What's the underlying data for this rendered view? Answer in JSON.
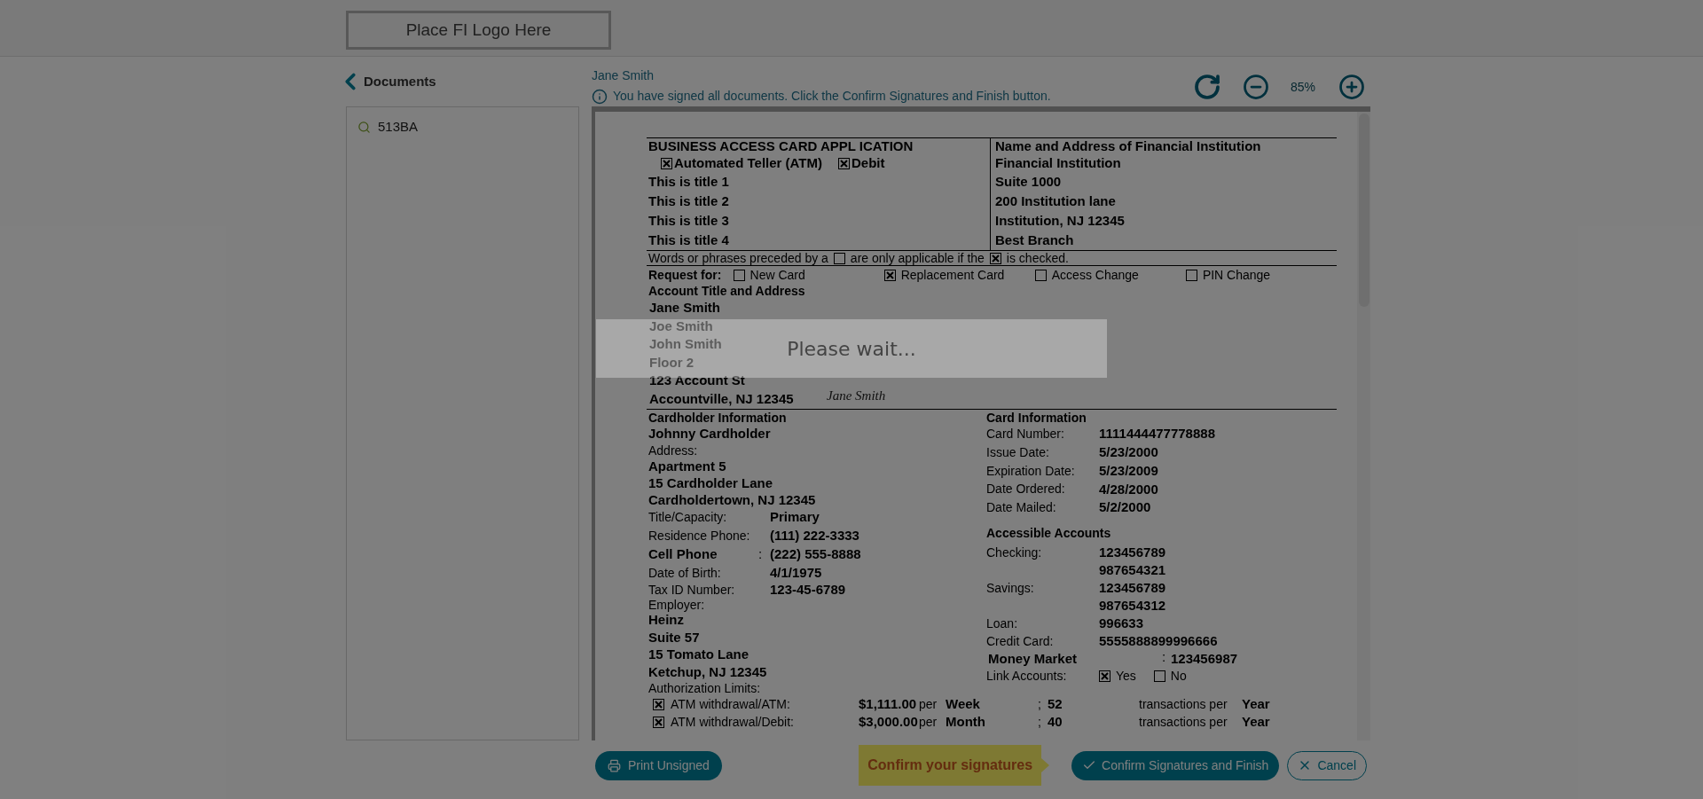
{
  "header": {
    "logo_text": "Place FI Logo Here"
  },
  "sidebar": {
    "back_label": "Documents",
    "items": [
      {
        "label": "513BA"
      }
    ]
  },
  "viewer": {
    "signer": "Jane Smith",
    "notice": "You have signed all documents. Click the Confirm Signatures and Finish button.",
    "zoom": "85%"
  },
  "document": {
    "top_left": {
      "title": "BUSINESS ACCESS CARD APPL ICATION",
      "options": [
        {
          "label": "Automated Teller (ATM)",
          "checked": true
        },
        {
          "label": "Debit",
          "checked": true
        }
      ],
      "titles": [
        "This is title 1",
        "This is title 2",
        "This is title 3",
        "This is title 4"
      ]
    },
    "top_right": {
      "title": "Name and Address of Financial Institution",
      "lines": [
        "Financial Institution",
        "Suite 1000",
        "200 Institution lane",
        "Institution, NJ 12345",
        "Best Branch"
      ]
    },
    "legend": [
      {
        "kind": "text",
        "text": "Words or phrases preceded by a"
      },
      {
        "kind": "box",
        "checked": false
      },
      {
        "kind": "text",
        "text": "are only applicable if the"
      },
      {
        "kind": "box",
        "checked": true
      },
      {
        "kind": "text",
        "text": "is checked."
      }
    ],
    "request": {
      "label": "Request for:",
      "options": [
        {
          "label": "New Card",
          "checked": false
        },
        {
          "label": "Replacement Card",
          "checked": true
        },
        {
          "label": "Access Change",
          "checked": false
        },
        {
          "label": "PIN Change",
          "checked": false
        }
      ]
    },
    "account": {
      "title": "Account Title and Address",
      "lines": [
        "Jane Smith",
        "Joe Smith",
        "John Smith",
        "Floor 2",
        "123 Account St",
        "Accountville, NJ 12345"
      ],
      "signature": "Jane Smith"
    },
    "cardholder": {
      "title": "Cardholder Information",
      "name": "Johnny Cardholder",
      "address_label": "Address:",
      "address_lines": [
        "Apartment 5",
        "15 Cardholder Lane",
        "Cardholdertown, NJ 12345"
      ],
      "fields": [
        {
          "kind": "plain",
          "label": "Title/Capacity:",
          "value": "Primary"
        },
        {
          "kind": "plain",
          "label": "Residence Phone:",
          "value": "(111) 222-3333"
        },
        {
          "kind": "bold",
          "label": "Cell Phone",
          "separator": ":",
          "value": "(222) 555-8888"
        },
        {
          "kind": "plain",
          "label": "Date of Birth:",
          "value": "4/1/1975"
        },
        {
          "kind": "plain",
          "label": "Tax ID Number:",
          "value": "123-45-6789"
        }
      ],
      "employer_label": "Employer:",
      "employer_lines": [
        "Heinz",
        "Suite 57",
        "15 Tomato Lane",
        "Ketchup, NJ 12345"
      ],
      "limits_label": "Authorization Limits:"
    },
    "card_info": {
      "title": "Card Information",
      "fields": [
        {
          "label": "Card Number:",
          "value": "1111444477778888"
        },
        {
          "label": "Issue Date:",
          "value": "5/23/2000"
        },
        {
          "label": "Expiration Date:",
          "value": "5/23/2009"
        },
        {
          "label": "Date Ordered:",
          "value": "4/28/2000"
        },
        {
          "label": "Date Mailed:",
          "value": "5/2/2000"
        }
      ],
      "accounts_title": "Accessible Accounts",
      "accounts": [
        {
          "kind": "plain",
          "label": "Checking:",
          "values": [
            "123456789",
            "987654321"
          ]
        },
        {
          "kind": "plain",
          "label": "Savings:",
          "values": [
            "123456789",
            "987654312"
          ]
        },
        {
          "kind": "plain",
          "label": "Loan:",
          "values": [
            "996633"
          ]
        },
        {
          "kind": "plain",
          "label": "Credit Card:",
          "values": [
            "5555888899996666"
          ]
        },
        {
          "kind": "bold",
          "label": "Money Market",
          "separator": ":",
          "values": [
            "123456987"
          ]
        }
      ],
      "link": {
        "label": "Link Accounts:",
        "options": [
          {
            "label": "Yes",
            "checked": true
          },
          {
            "label": "No",
            "checked": false
          }
        ]
      }
    },
    "limits": [
      {
        "checked": true,
        "label": "ATM withdrawal/ATM:",
        "amount": "$1,111.00",
        "per": "per",
        "period": "Week",
        "separator": ";",
        "count": "52",
        "tx_label": "transactions per",
        "tx_period": "Year"
      },
      {
        "checked": true,
        "label": "ATM withdrawal/Debit:",
        "amount": "$3,000.00",
        "per": "per",
        "period": "Month",
        "separator": ";",
        "count": "40",
        "tx_label": "transactions per",
        "tx_period": "Year"
      }
    ]
  },
  "footer": {
    "print_label": "Print Unsigned",
    "tooltip": "Confirm your signatures",
    "confirm_label": "Confirm Signatures and Finish",
    "cancel_label": "Cancel"
  },
  "loading": {
    "message": "Please wait..."
  }
}
